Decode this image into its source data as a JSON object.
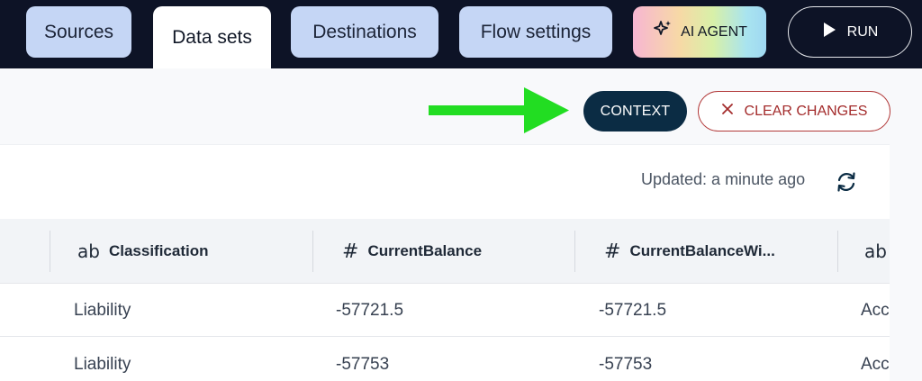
{
  "nav": {
    "tabs": [
      {
        "label": "Sources"
      },
      {
        "label": "Data sets"
      },
      {
        "label": "Destinations"
      },
      {
        "label": "Flow settings"
      }
    ],
    "ai_agent_label": "AI AGENT",
    "run_label": "RUN"
  },
  "toolbar": {
    "context_label": "CONTEXT",
    "clear_changes_label": "CLEAR CHANGES"
  },
  "status": {
    "updated_text": "Updated: a minute ago"
  },
  "table": {
    "columns": [
      {
        "type": "ab",
        "label": "Classification"
      },
      {
        "type": "#",
        "label": "CurrentBalance"
      },
      {
        "type": "#",
        "label": "CurrentBalanceWi..."
      },
      {
        "type": "ab",
        "label": ""
      }
    ],
    "rows": [
      [
        "Liability",
        "-57721.5",
        "-57721.5",
        "Acc"
      ],
      [
        "Liability",
        "-57753",
        "-57753",
        "Acc"
      ]
    ]
  },
  "colors": {
    "nav_bg": "#0d1326",
    "tab_bg": "#c5d6f5",
    "context_bg": "#0b2c44",
    "clear_border": "#b23a3a",
    "arrow": "#22dd22"
  }
}
